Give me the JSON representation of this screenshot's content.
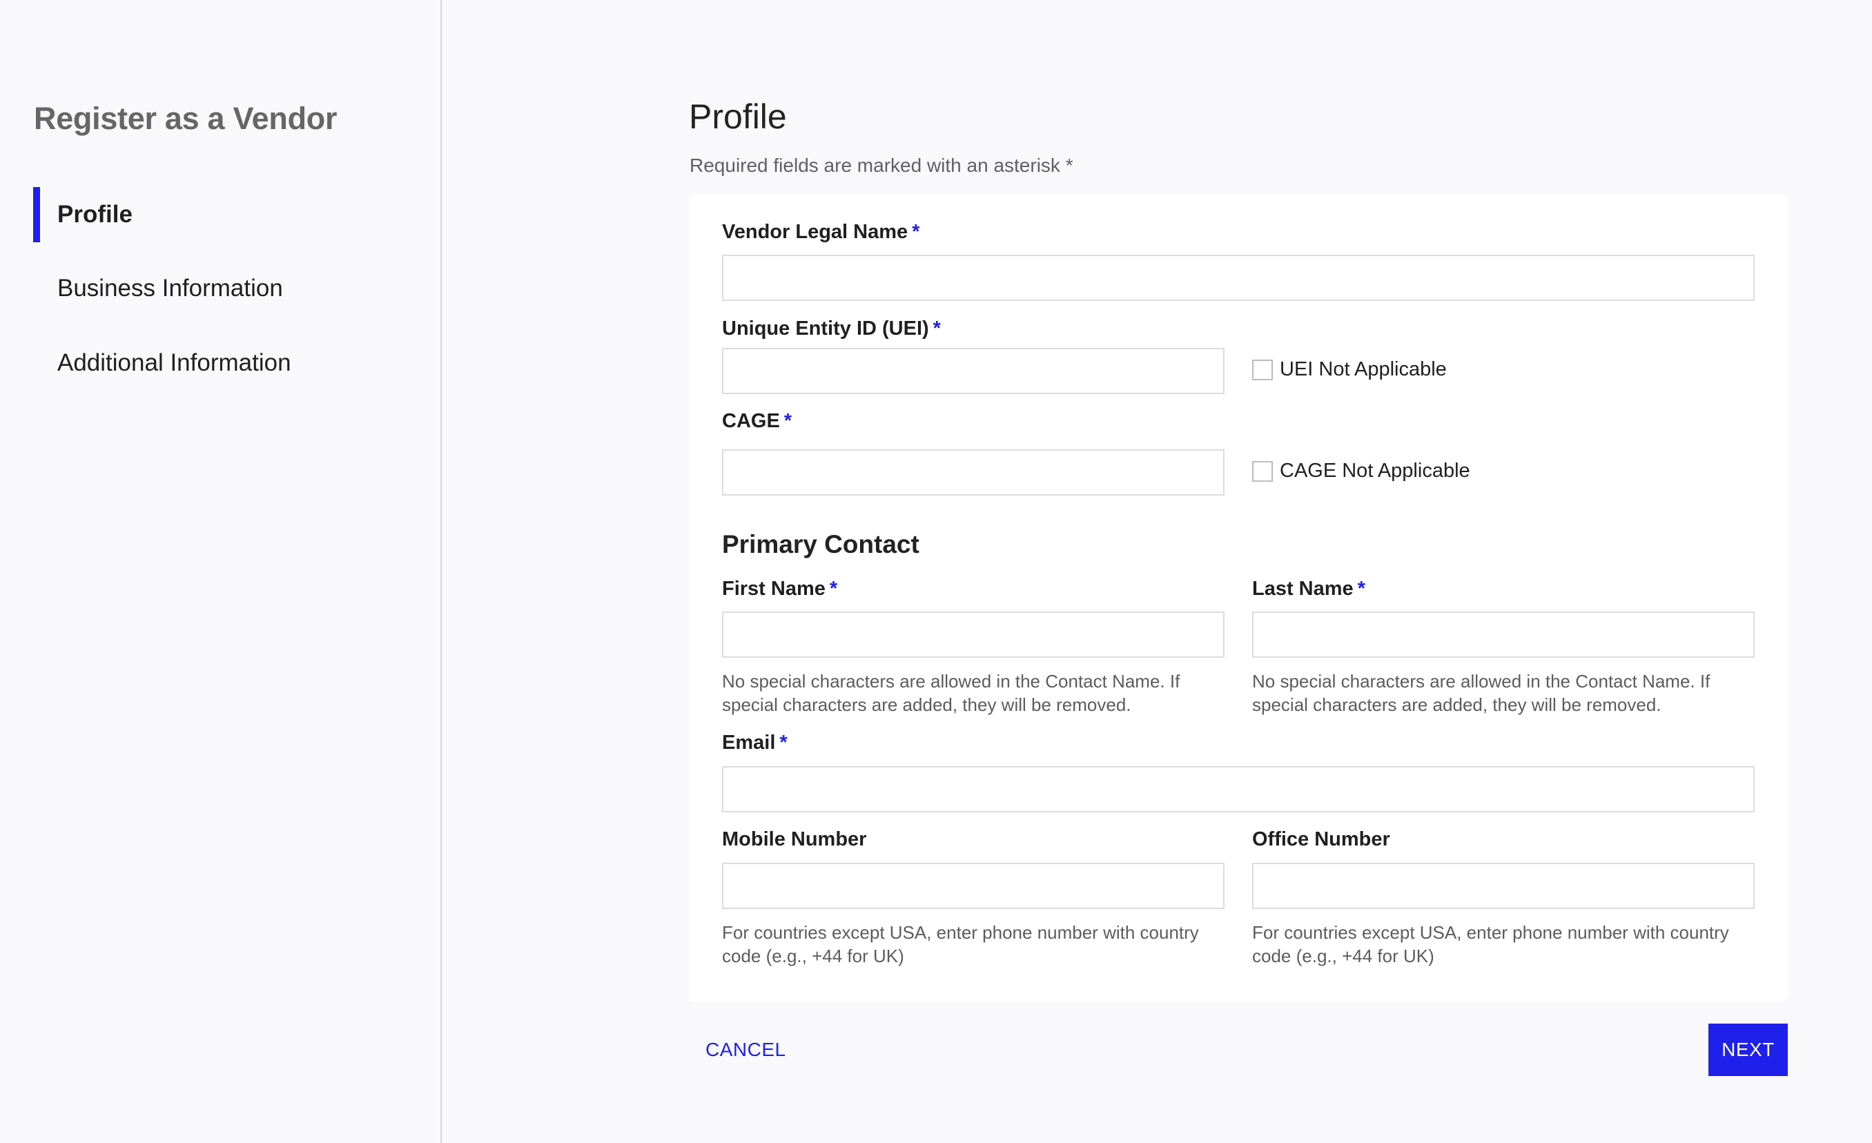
{
  "sidebar": {
    "title": "Register as a Vendor",
    "items": [
      {
        "label": "Profile",
        "active": true
      },
      {
        "label": "Business Information",
        "active": false
      },
      {
        "label": "Additional Information",
        "active": false
      }
    ]
  },
  "main": {
    "title": "Profile",
    "required_note": "Required fields are marked with an asterisk *",
    "required_marker": "*",
    "fields": {
      "vendor_legal_name": {
        "label": "Vendor Legal Name",
        "value": "",
        "placeholder": ""
      },
      "uei": {
        "label": "Unique Entity ID (UEI)",
        "value": "",
        "placeholder": "",
        "not_applicable_label": "UEI Not Applicable",
        "not_applicable_checked": false
      },
      "cage": {
        "label": "CAGE",
        "value": "",
        "placeholder": "",
        "not_applicable_label": "CAGE Not Applicable",
        "not_applicable_checked": false
      }
    },
    "primary_contact": {
      "title": "Primary Contact",
      "first_name": {
        "label": "First Name",
        "value": "",
        "helper": "No special characters are allowed in the Contact Name. If special characters are added, they will be removed."
      },
      "last_name": {
        "label": "Last Name",
        "value": "",
        "helper": "No special characters are allowed in the Contact Name. If special characters are added, they will be removed."
      },
      "email": {
        "label": "Email",
        "value": ""
      },
      "mobile": {
        "label": "Mobile Number",
        "value": "",
        "helper": "For countries except USA, enter phone number with country code (e.g., +44 for UK)"
      },
      "office": {
        "label": "Office Number",
        "value": "",
        "helper": "For countries except USA, enter phone number with country code (e.g., +44 for UK)"
      }
    }
  },
  "actions": {
    "cancel_label": "CANCEL",
    "next_label": "NEXT"
  },
  "colors": {
    "accent": "#2020ec",
    "background": "#f9f9fb",
    "card": "#ffffff",
    "divider": "#d8d8db"
  }
}
